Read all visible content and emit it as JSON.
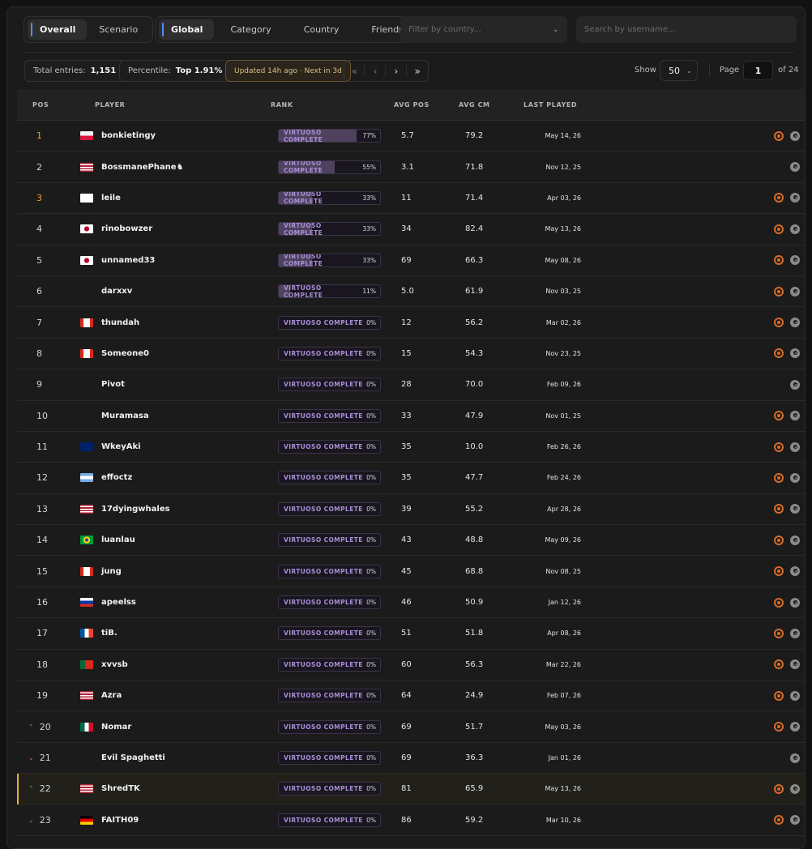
{
  "tabs_mode": [
    {
      "label": "Overall",
      "active": true
    },
    {
      "label": "Scenario",
      "active": false
    }
  ],
  "tabs_scope": [
    {
      "label": "Global",
      "active": true
    },
    {
      "label": "Category",
      "active": false
    },
    {
      "label": "Country",
      "active": false
    },
    {
      "label": "Friends",
      "active": false
    }
  ],
  "country_filter": {
    "placeholder": "Filter by country..."
  },
  "search": {
    "placeholder": "Search by username..."
  },
  "stats": {
    "total_label": "Total entries:",
    "total_value": "1,151",
    "percentile_label": "Percentile:",
    "percentile_value": "Top 1.91%",
    "updated": "Updated 14h ago · Next in 3d"
  },
  "pager": {
    "first": "«",
    "prev": "‹",
    "next": "›",
    "last": "»"
  },
  "show": {
    "label": "Show",
    "value": "50"
  },
  "page": {
    "label": "Page",
    "value": "1",
    "of": "of 24"
  },
  "columns": {
    "pos": "POS",
    "player": "PLAYER",
    "rank": "RANK",
    "avg_pos": "AVG POS",
    "avg_cm": "AVG CM",
    "last_played": "LAST PLAYED"
  },
  "rank_label": "VIRTUOSO COMPLETE",
  "rows": [
    {
      "pos": "1",
      "flag": "pl",
      "player": "bonkietingy",
      "pct": "77%",
      "fill": 0.77,
      "avg_pos": "5.7",
      "avg_cm": "79.2",
      "date": "May 14, 26",
      "icons": [
        "o",
        "s"
      ],
      "style": "gold"
    },
    {
      "pos": "2",
      "flag": "us",
      "player": "BossmanePhane♞",
      "pct": "55%",
      "fill": 0.55,
      "avg_pos": "3.1",
      "avg_cm": "71.8",
      "date": "Nov 12, 25",
      "icons": [
        "s"
      ],
      "style": "plain"
    },
    {
      "pos": "3",
      "flag": "fi",
      "player": "leile",
      "pct": "33%",
      "fill": 0.33,
      "avg_pos": "11",
      "avg_cm": "71.4",
      "date": "Apr 03, 26",
      "icons": [
        "o",
        "s"
      ],
      "style": "gold"
    },
    {
      "pos": "4",
      "flag": "jp",
      "player": "rinobowzer",
      "pct": "33%",
      "fill": 0.33,
      "avg_pos": "34",
      "avg_cm": "82.4",
      "date": "May 13, 26",
      "icons": [
        "o",
        "s"
      ],
      "style": "plain"
    },
    {
      "pos": "5",
      "flag": "jp",
      "player": "unnamed33",
      "pct": "33%",
      "fill": 0.33,
      "avg_pos": "69",
      "avg_cm": "66.3",
      "date": "May 08, 26",
      "icons": [
        "o",
        "s"
      ],
      "style": "plain"
    },
    {
      "pos": "6",
      "flag": "",
      "player": "darxxv",
      "pct": "11%",
      "fill": 0.11,
      "avg_pos": "5.0",
      "avg_cm": "61.9",
      "date": "Nov 03, 25",
      "icons": [
        "o",
        "s"
      ],
      "style": "plain"
    },
    {
      "pos": "7",
      "flag": "ca",
      "player": "thundah",
      "pct": "0%",
      "fill": 0,
      "avg_pos": "12",
      "avg_cm": "56.2",
      "date": "Mar 02, 26",
      "icons": [
        "o",
        "s"
      ],
      "style": "plain"
    },
    {
      "pos": "8",
      "flag": "ca",
      "player": "Someone0",
      "pct": "0%",
      "fill": 0,
      "avg_pos": "15",
      "avg_cm": "54.3",
      "date": "Nov 23, 25",
      "icons": [
        "o",
        "s"
      ],
      "style": "plain"
    },
    {
      "pos": "9",
      "flag": "",
      "player": "Pivot",
      "pct": "0%",
      "fill": 0,
      "avg_pos": "28",
      "avg_cm": "70.0",
      "date": "Feb 09, 26",
      "icons": [
        "s"
      ],
      "style": "plain"
    },
    {
      "pos": "10",
      "flag": "",
      "player": "Muramasa",
      "pct": "0%",
      "fill": 0,
      "avg_pos": "33",
      "avg_cm": "47.9",
      "date": "Nov 01, 25",
      "icons": [
        "o",
        "s"
      ],
      "style": "plain"
    },
    {
      "pos": "11",
      "flag": "gb",
      "player": "WkeyAki",
      "pct": "0%",
      "fill": 0,
      "avg_pos": "35",
      "avg_cm": "10.0",
      "date": "Feb 26, 26",
      "icons": [
        "o",
        "s"
      ],
      "style": "plain"
    },
    {
      "pos": "12",
      "flag": "ar",
      "player": "effoctz",
      "pct": "0%",
      "fill": 0,
      "avg_pos": "35",
      "avg_cm": "47.7",
      "date": "Feb 24, 26",
      "icons": [
        "o",
        "s"
      ],
      "style": "plain"
    },
    {
      "pos": "13",
      "flag": "us",
      "player": "17dyingwhales",
      "pct": "0%",
      "fill": 0,
      "avg_pos": "39",
      "avg_cm": "55.2",
      "date": "Apr 28, 26",
      "icons": [
        "o",
        "s"
      ],
      "style": "plain"
    },
    {
      "pos": "14",
      "flag": "br",
      "player": "luanlau",
      "pct": "0%",
      "fill": 0,
      "avg_pos": "43",
      "avg_cm": "48.8",
      "date": "May 09, 26",
      "icons": [
        "o",
        "s"
      ],
      "style": "plain"
    },
    {
      "pos": "15",
      "flag": "ca",
      "player": "jung",
      "pct": "0%",
      "fill": 0,
      "avg_pos": "45",
      "avg_cm": "68.8",
      "date": "Nov 08, 25",
      "icons": [
        "o",
        "s"
      ],
      "style": "plain"
    },
    {
      "pos": "16",
      "flag": "ru",
      "player": "apeelss",
      "pct": "0%",
      "fill": 0,
      "avg_pos": "46",
      "avg_cm": "50.9",
      "date": "Jan 12, 26",
      "icons": [
        "o",
        "s"
      ],
      "style": "plain"
    },
    {
      "pos": "17",
      "flag": "fr",
      "player": "tiB.",
      "pct": "0%",
      "fill": 0,
      "avg_pos": "51",
      "avg_cm": "51.8",
      "date": "Apr 08, 26",
      "icons": [
        "o",
        "s"
      ],
      "style": "plain"
    },
    {
      "pos": "18",
      "flag": "pt",
      "player": "xvvsb",
      "pct": "0%",
      "fill": 0,
      "avg_pos": "60",
      "avg_cm": "56.3",
      "date": "Mar 22, 26",
      "icons": [
        "o",
        "s"
      ],
      "style": "plain"
    },
    {
      "pos": "19",
      "flag": "us",
      "player": "Azra",
      "pct": "0%",
      "fill": 0,
      "avg_pos": "64",
      "avg_cm": "24.9",
      "date": "Feb 07, 26",
      "icons": [
        "o",
        "s"
      ],
      "style": "plain"
    },
    {
      "pos": "20",
      "flag": "mx",
      "player": "Nomar",
      "pct": "0%",
      "fill": 0,
      "avg_pos": "69",
      "avg_cm": "51.7",
      "date": "May 03, 26",
      "icons": [
        "o",
        "s"
      ],
      "style": "up"
    },
    {
      "pos": "21",
      "flag": "",
      "player": "Evil Spaghetti",
      "pct": "0%",
      "fill": 0,
      "avg_pos": "69",
      "avg_cm": "36.3",
      "date": "Jan 01, 26",
      "icons": [
        "s"
      ],
      "style": "down"
    },
    {
      "pos": "22",
      "flag": "us",
      "player": "ShredTK",
      "pct": "0%",
      "fill": 0,
      "avg_pos": "81",
      "avg_cm": "65.9",
      "date": "May 13, 26",
      "icons": [
        "o",
        "s"
      ],
      "style": "up",
      "highlight": true
    },
    {
      "pos": "23",
      "flag": "de",
      "player": "FAITH09",
      "pct": "0%",
      "fill": 0,
      "avg_pos": "86",
      "avg_cm": "59.2",
      "date": "Mar 10, 26",
      "icons": [
        "o",
        "s"
      ],
      "style": "down"
    }
  ],
  "colors": {
    "accent_blue": "#4d8ff7",
    "gold": "#f0a52a",
    "highlight": "#e6b325",
    "rank_purple": "#a98ed6",
    "orange_icon": "#d66b28"
  }
}
